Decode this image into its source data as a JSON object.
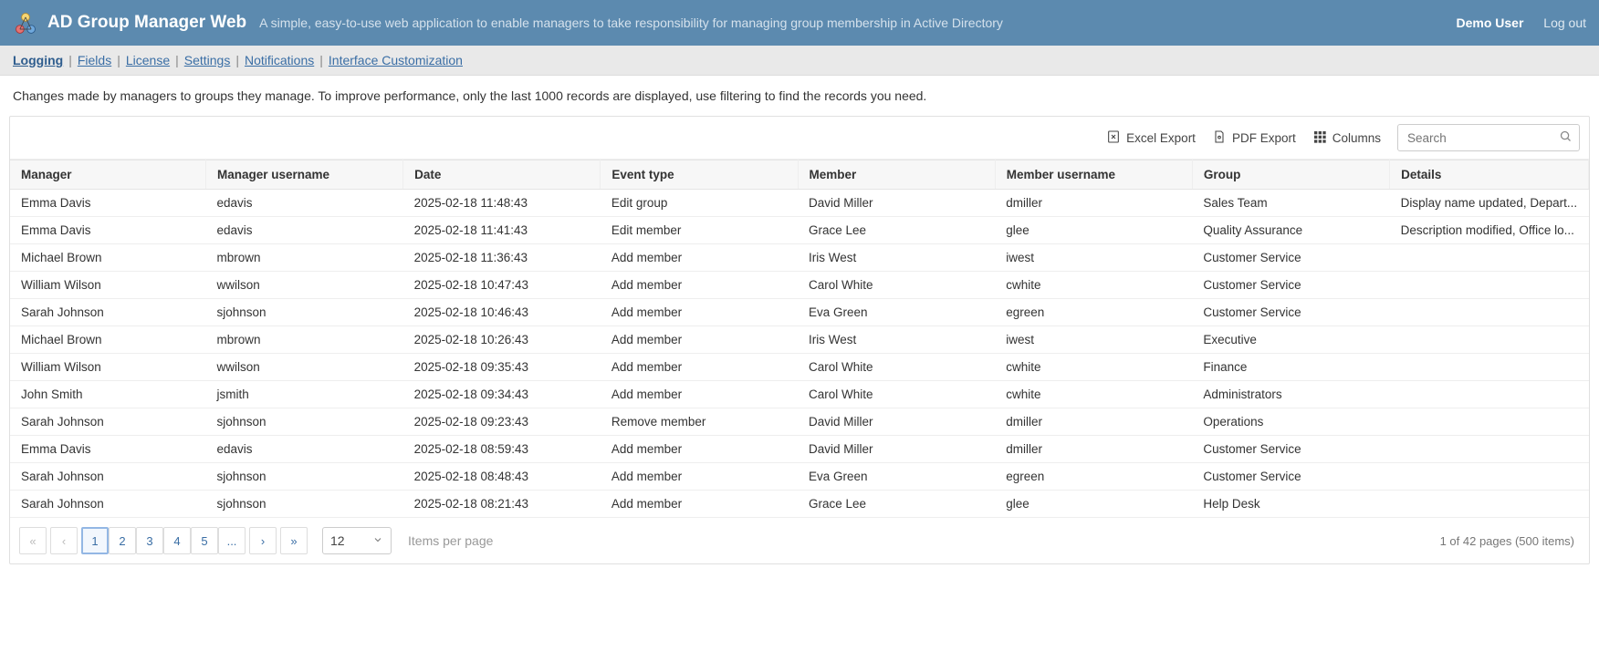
{
  "header": {
    "app_title": "AD Group Manager Web",
    "tagline": "A simple, easy-to-use web application to enable managers to take responsibility for managing group membership in Active Directory",
    "user_label": "Demo User",
    "logout_label": "Log out"
  },
  "nav": {
    "items": [
      {
        "label": "Logging",
        "active": true
      },
      {
        "label": "Fields"
      },
      {
        "label": "License"
      },
      {
        "label": "Settings"
      },
      {
        "label": "Notifications"
      },
      {
        "label": "Interface Customization"
      }
    ]
  },
  "intro_text": "Changes made by managers to groups they manage. To improve performance, only the last 1000 records are displayed, use filtering to find the records you need.",
  "toolbar": {
    "excel_label": "Excel Export",
    "pdf_label": "PDF Export",
    "columns_label": "Columns",
    "search_placeholder": "Search"
  },
  "columns": [
    "Manager",
    "Manager username",
    "Date",
    "Event type",
    "Member",
    "Member username",
    "Group",
    "Details"
  ],
  "col_widths": [
    "12.4%",
    "12.5%",
    "12.5%",
    "12.5%",
    "12.5%",
    "12.5%",
    "12.5%",
    "12.6%"
  ],
  "rows": [
    {
      "manager": "Emma Davis",
      "manager_user": "edavis",
      "date": "2025-02-18 11:48:43",
      "event": "Edit group",
      "member": "David Miller",
      "member_user": "dmiller",
      "group": "Sales Team",
      "details": "Display name updated, Depart..."
    },
    {
      "manager": "Emma Davis",
      "manager_user": "edavis",
      "date": "2025-02-18 11:41:43",
      "event": "Edit member",
      "member": "Grace Lee",
      "member_user": "glee",
      "group": "Quality Assurance",
      "details": "Description modified, Office lo..."
    },
    {
      "manager": "Michael Brown",
      "manager_user": "mbrown",
      "date": "2025-02-18 11:36:43",
      "event": "Add member",
      "member": "Iris West",
      "member_user": "iwest",
      "group": "Customer Service",
      "details": ""
    },
    {
      "manager": "William Wilson",
      "manager_user": "wwilson",
      "date": "2025-02-18 10:47:43",
      "event": "Add member",
      "member": "Carol White",
      "member_user": "cwhite",
      "group": "Customer Service",
      "details": ""
    },
    {
      "manager": "Sarah Johnson",
      "manager_user": "sjohnson",
      "date": "2025-02-18 10:46:43",
      "event": "Add member",
      "member": "Eva Green",
      "member_user": "egreen",
      "group": "Customer Service",
      "details": ""
    },
    {
      "manager": "Michael Brown",
      "manager_user": "mbrown",
      "date": "2025-02-18 10:26:43",
      "event": "Add member",
      "member": "Iris West",
      "member_user": "iwest",
      "group": "Executive",
      "details": ""
    },
    {
      "manager": "William Wilson",
      "manager_user": "wwilson",
      "date": "2025-02-18 09:35:43",
      "event": "Add member",
      "member": "Carol White",
      "member_user": "cwhite",
      "group": "Finance",
      "details": ""
    },
    {
      "manager": "John Smith",
      "manager_user": "jsmith",
      "date": "2025-02-18 09:34:43",
      "event": "Add member",
      "member": "Carol White",
      "member_user": "cwhite",
      "group": "Administrators",
      "details": ""
    },
    {
      "manager": "Sarah Johnson",
      "manager_user": "sjohnson",
      "date": "2025-02-18 09:23:43",
      "event": "Remove member",
      "member": "David Miller",
      "member_user": "dmiller",
      "group": "Operations",
      "details": ""
    },
    {
      "manager": "Emma Davis",
      "manager_user": "edavis",
      "date": "2025-02-18 08:59:43",
      "event": "Add member",
      "member": "David Miller",
      "member_user": "dmiller",
      "group": "Customer Service",
      "details": ""
    },
    {
      "manager": "Sarah Johnson",
      "manager_user": "sjohnson",
      "date": "2025-02-18 08:48:43",
      "event": "Add member",
      "member": "Eva Green",
      "member_user": "egreen",
      "group": "Customer Service",
      "details": ""
    },
    {
      "manager": "Sarah Johnson",
      "manager_user": "sjohnson",
      "date": "2025-02-18 08:21:43",
      "event": "Add member",
      "member": "Grace Lee",
      "member_user": "glee",
      "group": "Help Desk",
      "details": ""
    }
  ],
  "pager": {
    "pages": [
      "1",
      "2",
      "3",
      "4",
      "5",
      "..."
    ],
    "active_page": "1",
    "page_size": "12",
    "items_label": "Items per page",
    "summary": "1 of 42 pages (500 items)"
  }
}
